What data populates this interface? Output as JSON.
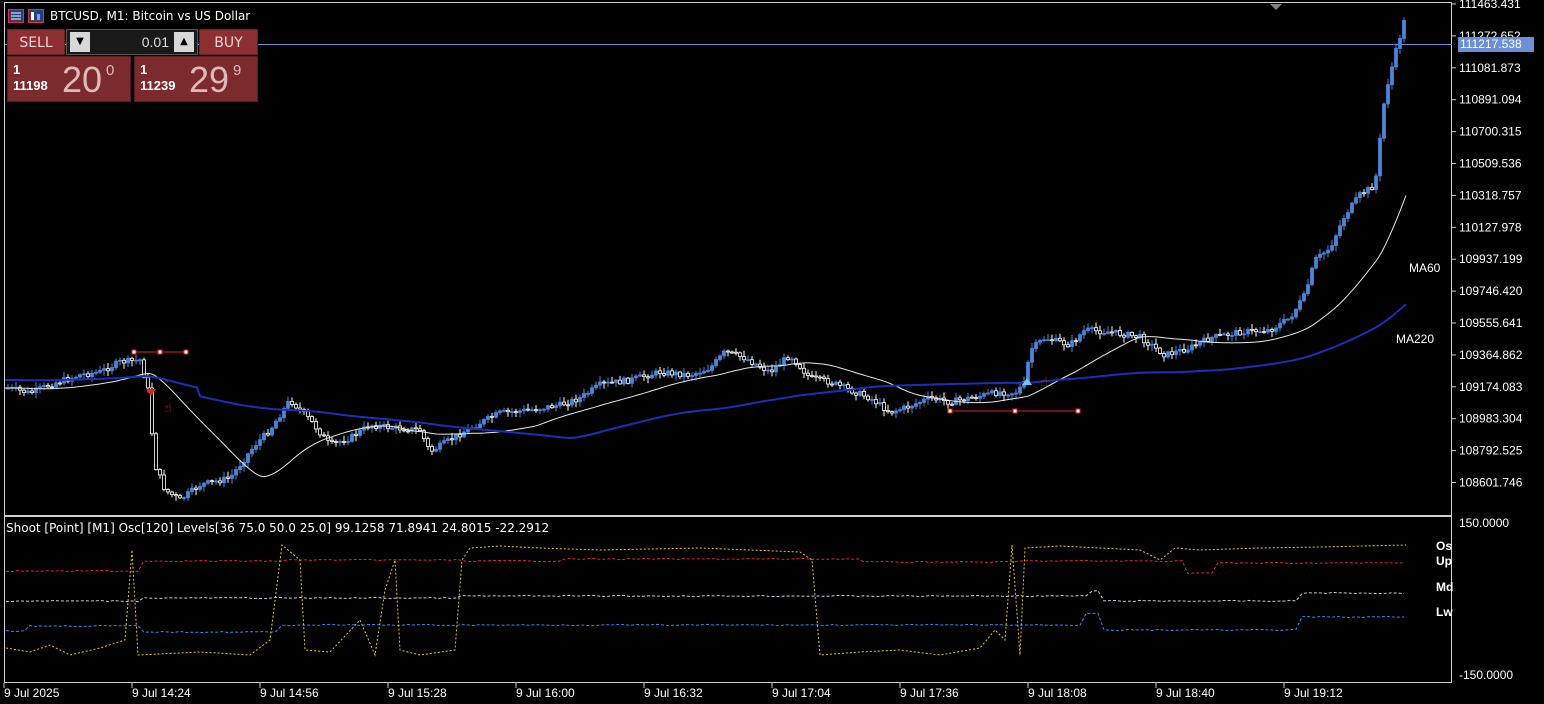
{
  "window": {
    "title": "BTCUSD, M1:  Bitcoin vs US Dollar"
  },
  "trade_panel": {
    "sell_label": "SELL",
    "buy_label": "BUY",
    "lot_value": "0.01",
    "sell_price": {
      "top": "1",
      "bottom": "11198",
      "big": "20",
      "sup": "0"
    },
    "buy_price": {
      "top": "1",
      "bottom": "11239",
      "big": "29",
      "sup": "9"
    }
  },
  "price_axis": {
    "ticks": [
      "111463.431",
      "111272.652",
      "111081.873",
      "110891.094",
      "110700.315",
      "110509.536",
      "110318.757",
      "110127.978",
      "109937.199",
      "109746.420",
      "109555.641",
      "109364.862",
      "109174.083",
      "108983.304",
      "108792.525",
      "108601.746"
    ],
    "current_price": "111217.538",
    "current_price_color": "#6d8fd8"
  },
  "indicator_labels": {
    "ma60": "MA60",
    "ma220": "MA220"
  },
  "subwindow": {
    "label": "Shoot [Point] [M1]  Osc[120]  Levels[36 75.0 50.0 25.0] 99.1258 71.8941 24.8015 -22.2912",
    "axis_top": "150.0000",
    "axis_bottom": "-150.0000",
    "legend": [
      {
        "name": "Os",
        "color": "#e8c33a"
      },
      {
        "name": "Up",
        "color": "#e0243a"
      },
      {
        "name": "Md",
        "color": "#c8c8d8"
      },
      {
        "name": "Lw",
        "color": "#3a8ae8"
      }
    ]
  },
  "time_axis": {
    "labels": [
      "9 Jul 2025",
      "9 Jul 14:24",
      "9 Jul 14:56",
      "9 Jul 15:28",
      "9 Jul 16:00",
      "9 Jul 16:32",
      "9 Jul 17:04",
      "9 Jul 17:36",
      "9 Jul 18:08",
      "9 Jul 18:40",
      "9 Jul 19:12"
    ]
  },
  "colors": {
    "candle_up": "#4a86d8",
    "candle_down": "#ffffff",
    "ma60": "#e8e8e8",
    "ma220": "#1a2fb8",
    "trade_line": "#e02020",
    "panel_red": "#8c2f33"
  }
}
